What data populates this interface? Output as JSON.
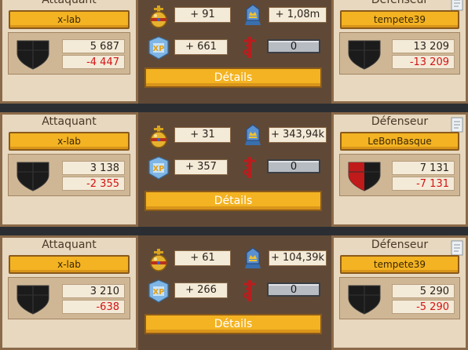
{
  "labels": {
    "attacker": "Attaquant",
    "defender": "Défenseur",
    "details": "Détails"
  },
  "icons": {
    "orb": "crown-orb-icon",
    "trophy": "trophy-blue-icon",
    "xp": "xp-shield-icon",
    "medic": "caduceus-icon",
    "shield": "shield-icon",
    "paper": "report-paper-icon"
  },
  "colors": {
    "accent": "#f3b322",
    "negative": "#d41414",
    "shield_black": "#1b1b1b",
    "shield_red": "#c01a1a"
  },
  "reports": [
    {
      "attacker": {
        "name": "x-lab",
        "value": "5 687",
        "loss": "-4 447",
        "shield_color": "black"
      },
      "defender": {
        "name": "tempete39",
        "value": "13 209",
        "loss": "-13 209",
        "shield_color": "black"
      },
      "orb": "+ 91",
      "trophy": "+ 1,08m",
      "xp": "+ 661",
      "medic": "0"
    },
    {
      "attacker": {
        "name": "x-lab",
        "value": "3 138",
        "loss": "-2 355",
        "shield_color": "black"
      },
      "defender": {
        "name": "LeBonBasque",
        "value": "7 131",
        "loss": "-7 131",
        "shield_color": "red"
      },
      "orb": "+ 31",
      "trophy": "+ 343,94k",
      "xp": "+ 357",
      "medic": "0"
    },
    {
      "attacker": {
        "name": "x-lab",
        "value": "3 210",
        "loss": "-638",
        "shield_color": "black"
      },
      "defender": {
        "name": "tempete39",
        "value": "5 290",
        "loss": "-5 290",
        "shield_color": "black"
      },
      "orb": "+ 61",
      "trophy": "+ 104,39k",
      "xp": "+ 266",
      "medic": "0"
    }
  ]
}
